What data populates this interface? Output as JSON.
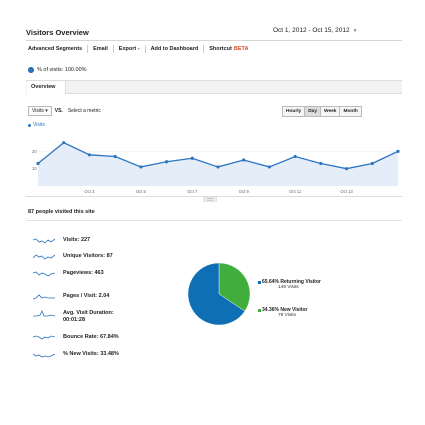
{
  "header": {
    "title": "Visitors Overview",
    "date_range": "Oct 1, 2012 - Oct 15, 2012"
  },
  "toolbar": {
    "items": [
      "Advanced Segments",
      "Email",
      "Export -",
      "Add to Dashboard",
      "Shortcut"
    ],
    "beta_label": "BETA"
  },
  "segment": {
    "label": "% of visits: 100.00%"
  },
  "tabs": {
    "overview": "Overview"
  },
  "metric_picker": {
    "selected": "Visits",
    "vs_label": "VS.",
    "select_link": "Select a metric"
  },
  "range_buttons": [
    {
      "label": "Hourly",
      "active": false
    },
    {
      "label": "Day",
      "active": true
    },
    {
      "label": "Week",
      "active": false
    },
    {
      "label": "Month",
      "active": false
    }
  ],
  "chart_data": {
    "type": "area",
    "series": [
      {
        "name": "Visits",
        "values": [
          13,
          25,
          18,
          17,
          11,
          14,
          16,
          11,
          15,
          11,
          17,
          13,
          10,
          13,
          20
        ]
      }
    ],
    "x": [
      "Oct 1",
      "Oct 2",
      "Oct 3",
      "Oct 4",
      "Oct 5",
      "Oct 6",
      "Oct 7",
      "Oct 8",
      "Oct 9",
      "Oct 10",
      "Oct 11",
      "Oct 12",
      "Oct 13",
      "Oct 14",
      "Oct 15"
    ],
    "xtick_labels": [
      "Oct 3",
      "Oct 5",
      "Oct 7",
      "Oct 9",
      "Oct 11",
      "Oct 13"
    ],
    "ytick_labels": [
      "20",
      "10"
    ],
    "ylim": [
      0,
      30
    ],
    "legend": "top-left",
    "color": "#2b75c2",
    "fill": "#e5eef8"
  },
  "summary": {
    "heading": "87 people visited this site",
    "metrics": [
      {
        "label": "Visits:",
        "value": "227"
      },
      {
        "label": "Unique Visitors:",
        "value": "87"
      },
      {
        "label": "Pageviews:",
        "value": "463"
      },
      {
        "label": "Pages / Visit:",
        "value": "2.04"
      },
      {
        "label": "Avg. Visit Duration:",
        "value": "00:01:28"
      },
      {
        "label": "Bounce Rate:",
        "value": "67.84%"
      },
      {
        "label": "% New Visits:",
        "value": "33.48%"
      }
    ]
  },
  "visitor_pie": {
    "returning": {
      "label": "65.64% Returning Visitor",
      "visits": "149 Visits",
      "fraction": 0.6564,
      "color": "#0e6fb4"
    },
    "new": {
      "label": "34.36% New Visitor",
      "visits": "78 Visits",
      "fraction": 0.3436,
      "color": "#3fae3d"
    }
  },
  "icons": {
    "segment_dot": "segment-dot-icon",
    "date_caret": "chevron-down-icon"
  }
}
